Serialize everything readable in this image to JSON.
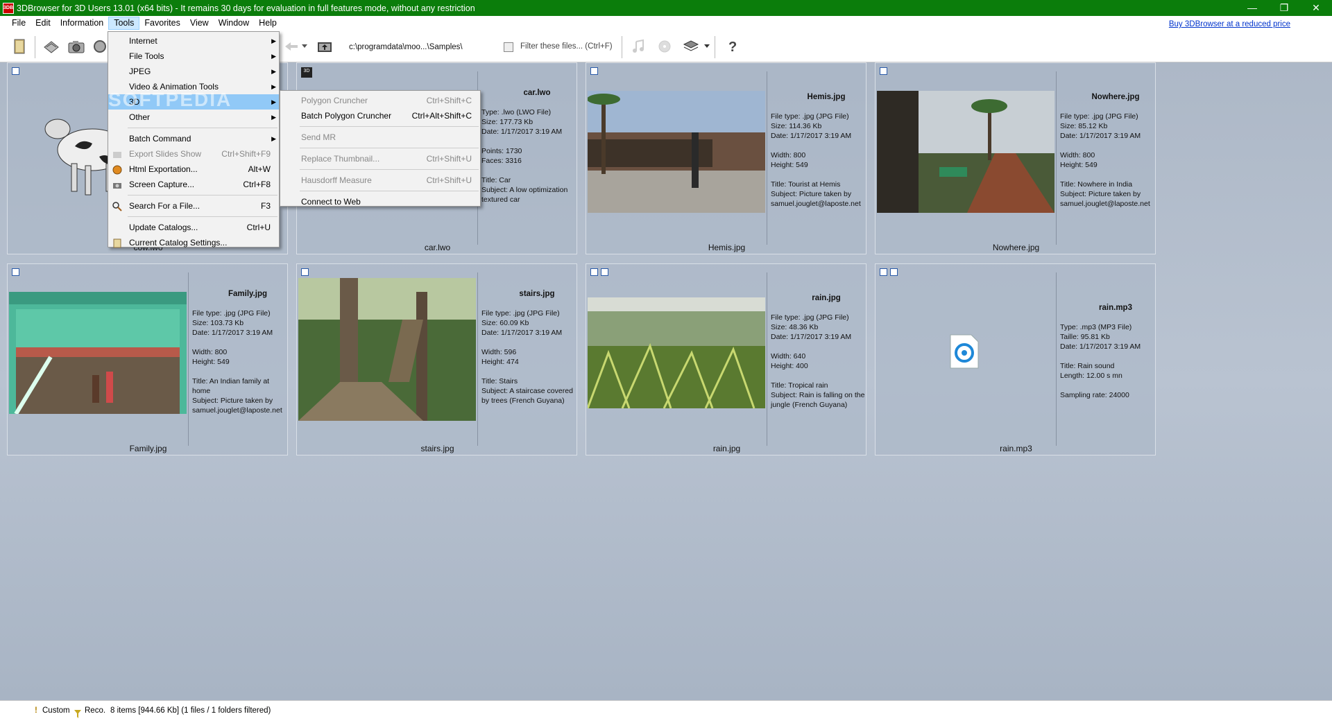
{
  "window": {
    "title": "3DBrowser for 3D Users 13.01 (x64 bits) - It remains 30 days for evaluation in full features mode, without any restriction",
    "app_icon_text": "3DB",
    "minimize": "—",
    "restore": "❐",
    "close": "✕"
  },
  "menubar": {
    "items": [
      "File",
      "Edit",
      "Information",
      "Tools",
      "Favorites",
      "View",
      "Window",
      "Help"
    ],
    "buy_link": "Buy 3DBrowser at a reduced price"
  },
  "toolbar": {
    "path": "c:\\programdata\\moo...\\Samples\\",
    "filter_placeholder": "Filter these files... (Ctrl+F)"
  },
  "tools_menu": {
    "items": [
      {
        "label": "Internet",
        "submenu": true
      },
      {
        "label": "File Tools",
        "submenu": true
      },
      {
        "label": "JPEG",
        "submenu": true
      },
      {
        "label": "Video & Animation Tools",
        "submenu": true
      },
      {
        "label": "3D",
        "submenu": true,
        "highlight": true
      },
      {
        "label": "Other",
        "submenu": true
      },
      {
        "label": "Batch Command",
        "submenu": true
      },
      {
        "label": "Export Slides Show",
        "shortcut": "Ctrl+Shift+F9",
        "disabled": true
      },
      {
        "label": "Html Exportation...",
        "shortcut": "Alt+W"
      },
      {
        "label": "Screen Capture...",
        "shortcut": "Ctrl+F8"
      },
      {
        "label": "Search For a File...",
        "shortcut": "F3"
      },
      {
        "label": "Update Catalogs...",
        "shortcut": "Ctrl+U"
      },
      {
        "label": "Current Catalog Settings..."
      }
    ]
  },
  "submenu_3d": {
    "items": [
      {
        "label": "Polygon Cruncher",
        "shortcut": "Ctrl+Shift+C",
        "disabled": true
      },
      {
        "label": "Batch Polygon Cruncher",
        "shortcut": "Ctrl+Alt+Shift+C"
      },
      {
        "label": "Send MR",
        "disabled": true
      },
      {
        "label": "Replace Thumbnail...",
        "shortcut": "Ctrl+Shift+U",
        "disabled": true
      },
      {
        "label": "Hausdorff Measure",
        "shortcut": "Ctrl+Shift+U",
        "disabled": true
      },
      {
        "label": "Connect to Web"
      }
    ]
  },
  "watermark": "SOFTPEDIA",
  "files": [
    {
      "caption": "cow.lwo",
      "title": "",
      "lines": []
    },
    {
      "caption": "car.lwo",
      "title": "car.lwo",
      "lines": [
        "Type: .lwo (LWO File)",
        "Size: 177.73 Kb",
        "Date: 1/17/2017 3:19 AM",
        "",
        "Points: 1730",
        "Faces: 3316",
        "",
        "Title: Car",
        "Subject: A low optimization textured car"
      ]
    },
    {
      "caption": "Hemis.jpg",
      "title": "Hemis.jpg",
      "lines": [
        "File type: .jpg (JPG File)",
        "Size: 114.36 Kb",
        "Date: 1/17/2017 3:19 AM",
        "",
        "Width: 800",
        "Height: 549",
        "",
        "Title: Tourist at Hemis",
        "Subject: Picture taken by samuel.jouglet@laposte.net"
      ]
    },
    {
      "caption": "Nowhere.jpg",
      "title": "Nowhere.jpg",
      "lines": [
        "File type: .jpg (JPG File)",
        "Size: 85.12 Kb",
        "Date: 1/17/2017 3:19 AM",
        "",
        "Width: 800",
        "Height: 549",
        "",
        "Title: Nowhere in India",
        "Subject: Picture taken by samuel.jouglet@laposte.net"
      ]
    },
    {
      "caption": "Family.jpg",
      "title": "Family.jpg",
      "lines": [
        "File type: .jpg (JPG File)",
        "Size: 103.73 Kb",
        "Date: 1/17/2017 3:19 AM",
        "",
        "Width: 800",
        "Height: 549",
        "",
        "Title: An Indian family at home",
        "Subject: Picture taken by samuel.jouglet@laposte.net"
      ]
    },
    {
      "caption": "stairs.jpg",
      "title": "stairs.jpg",
      "lines": [
        "File type: .jpg (JPG File)",
        "Size: 60.09 Kb",
        "Date: 1/17/2017 3:19 AM",
        "",
        "Width: 596",
        "Height: 474",
        "",
        "Title: Stairs",
        "Subject: A staircase covered by trees (French Guyana)"
      ]
    },
    {
      "caption": "rain.jpg",
      "title": "rain.jpg",
      "lines": [
        "File type: .jpg (JPG File)",
        "Size: 48.36 Kb",
        "Date: 1/17/2017 3:19 AM",
        "",
        "Width: 640",
        "Height: 400",
        "",
        "Title: Tropical rain",
        "Subject: Rain is falling on the jungle (French Guyana)"
      ]
    },
    {
      "caption": "rain.mp3",
      "title": "rain.mp3",
      "lines": [
        "Type: .mp3 (MP3 File)",
        "Taille: 95.81 Kb",
        "Date: 1/17/2017 3:19 AM",
        "",
        "Title: Rain sound",
        "Length: 12.00 s mn",
        "",
        "Sampling rate: 24000"
      ]
    }
  ],
  "statusbar": {
    "custom": "Custom",
    "reco": "Reco.",
    "summary": "8 items [944.66 Kb] (1 files / 1 folders filtered)"
  }
}
